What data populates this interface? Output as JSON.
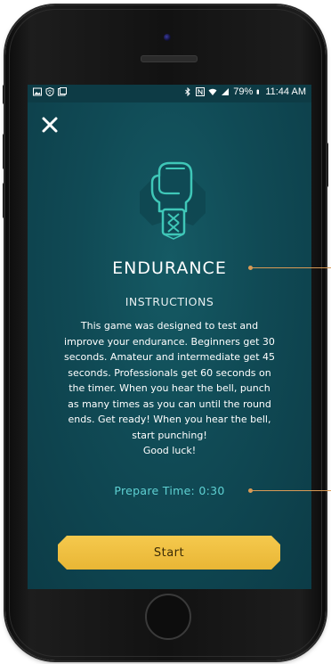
{
  "status_bar": {
    "battery": "79%",
    "time": "11:44 AM"
  },
  "close": {
    "icon": "close-icon",
    "glyph": "✕"
  },
  "game": {
    "logo_icon": "boxing-glove-icon",
    "title": "ENDURANCE",
    "instructions_heading": "INSTRUCTIONS",
    "instructions_text": "This game was designed to test and\nimprove your endurance. Beginners get 30\nseconds. Amateur and intermediate get 45\nseconds. Professionals get 60 seconds on\nthe timer. When you hear the bell, punch\nas many times as you can until the round\nends. Get ready! When you hear the bell,\nstart punching!\nGood luck!",
    "prepare_time": "Prepare Time: 0:30",
    "start_label": "Start"
  },
  "colors": {
    "accent_teal": "#5fd1d3",
    "button_gold": "#f0c040",
    "screen_bg": "#104a55",
    "annotation": "#d99a55"
  }
}
